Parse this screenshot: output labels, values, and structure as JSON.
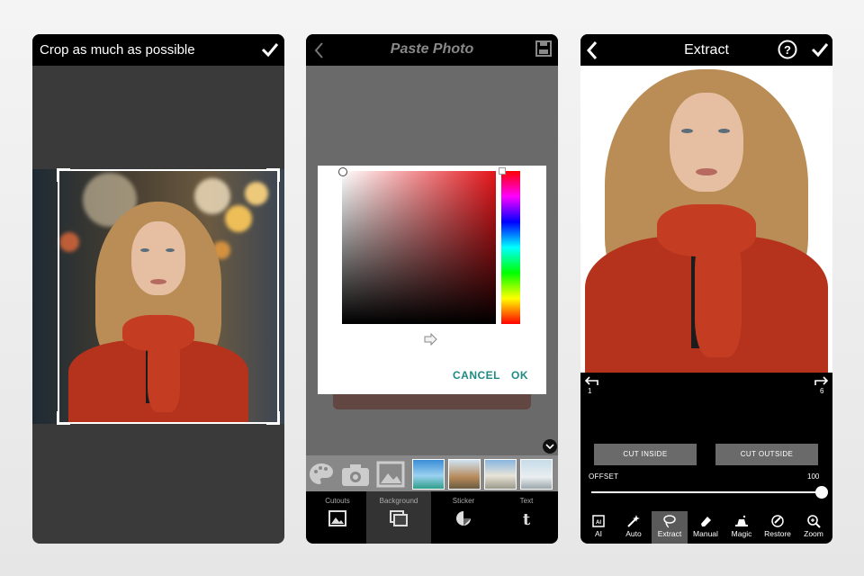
{
  "screen1": {
    "title": "Crop as much as possible",
    "confirm_icon": "checkmark-icon"
  },
  "screen2": {
    "title": "Paste Photo",
    "back_icon": "back-arrow-icon",
    "save_icon": "save-icon",
    "dialog": {
      "cancel_label": "CANCEL",
      "ok_label": "OK",
      "selected_color": "#e3151a"
    },
    "tabs": [
      {
        "label": "Cutouts",
        "icon": "image-icon"
      },
      {
        "label": "Background",
        "icon": "layers-icon"
      },
      {
        "label": "Sticker",
        "icon": "sticker-icon"
      },
      {
        "label": "Text",
        "icon": "text-icon"
      }
    ]
  },
  "screen3": {
    "title": "Extract",
    "undo_count": "1",
    "redo_count": "6",
    "cut_inside_label": "CUT INSIDE",
    "cut_outside_label": "CUT OUTSIDE",
    "offset_label": "OFFSET",
    "offset_value": "100",
    "offset_fraction": 1.0,
    "tools": [
      {
        "label": "AI",
        "icon": "ai-chip-icon"
      },
      {
        "label": "Auto",
        "icon": "magic-wand-icon"
      },
      {
        "label": "Extract",
        "icon": "lasso-icon",
        "active": true
      },
      {
        "label": "Manual",
        "icon": "eraser-icon"
      },
      {
        "label": "Magic",
        "icon": "magic-hat-icon"
      },
      {
        "label": "Restore",
        "icon": "restore-icon"
      },
      {
        "label": "Zoom",
        "icon": "zoom-icon"
      }
    ]
  }
}
